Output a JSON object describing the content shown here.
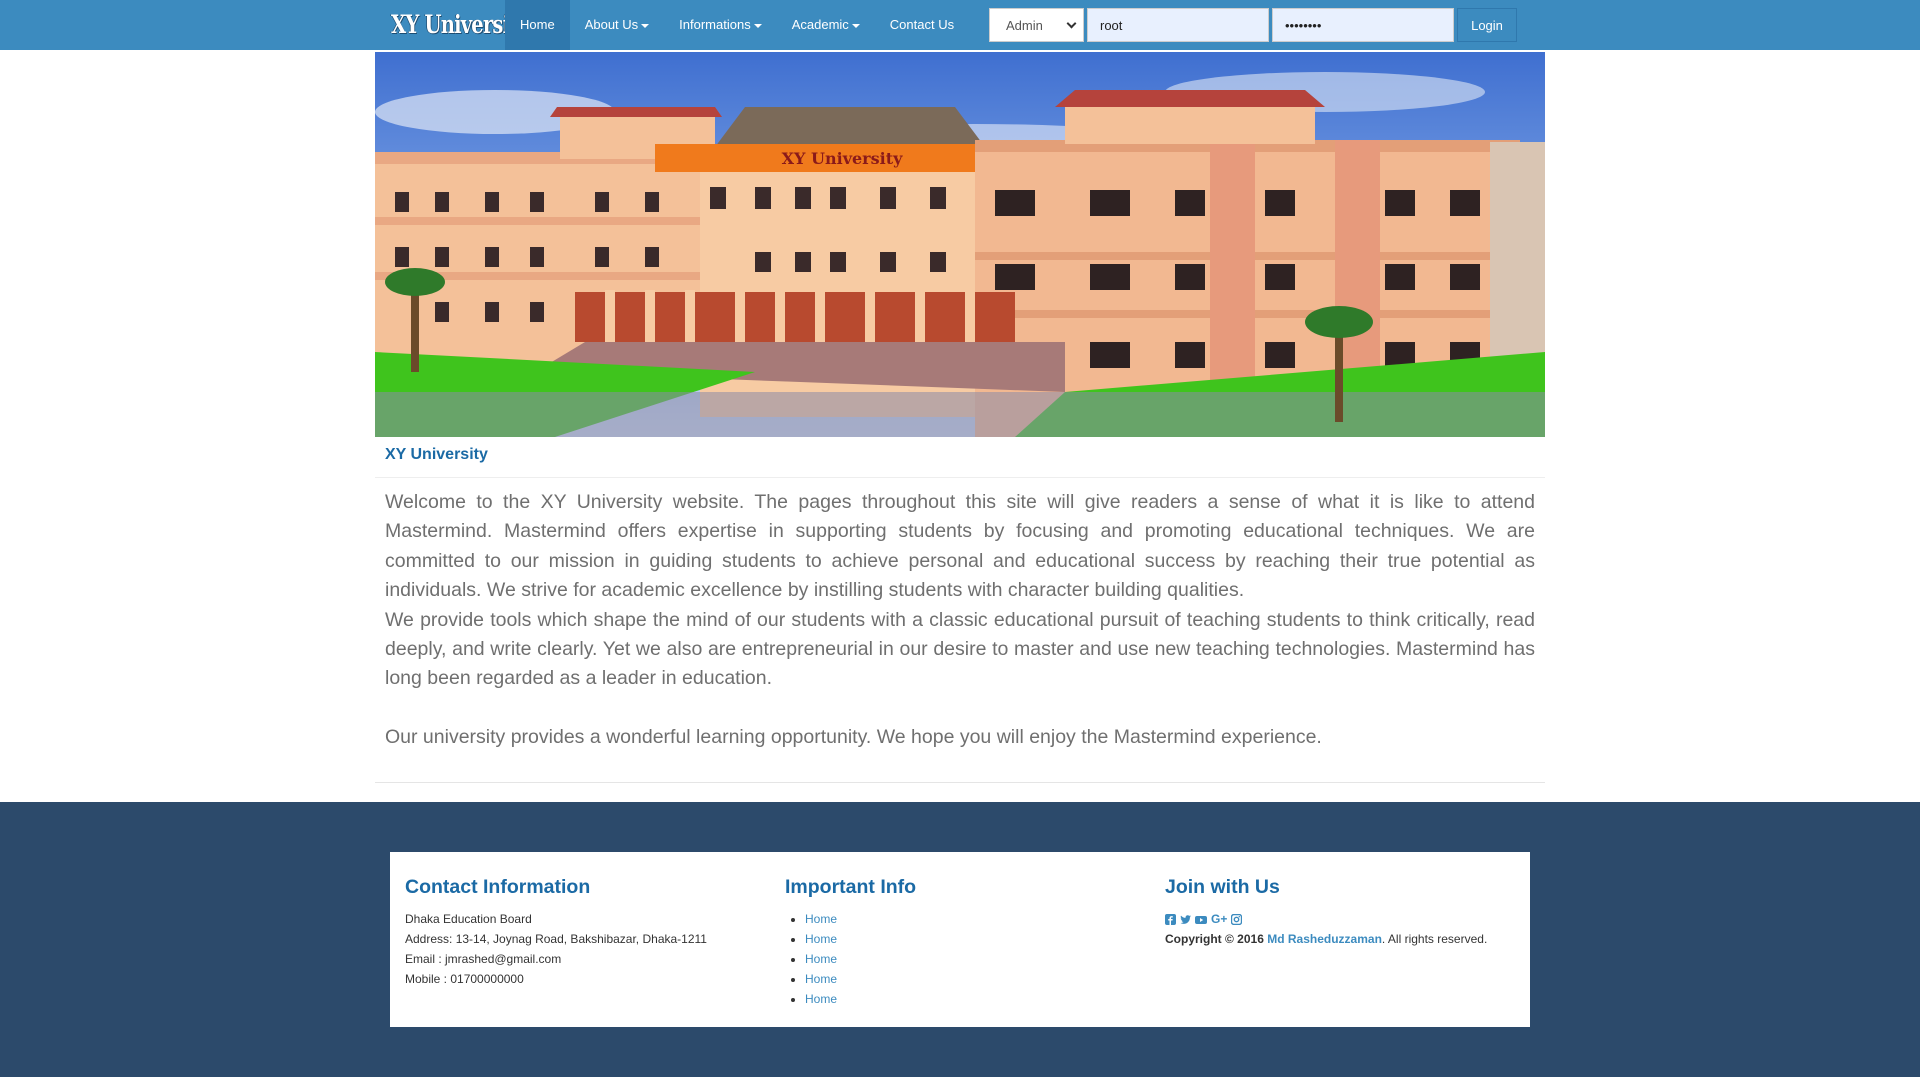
{
  "navbar": {
    "brand": "XY University",
    "items": [
      {
        "label": "Home",
        "active": true,
        "dropdown": false
      },
      {
        "label": "About Us",
        "active": false,
        "dropdown": true
      },
      {
        "label": "Informations",
        "active": false,
        "dropdown": true
      },
      {
        "label": "Academic",
        "active": false,
        "dropdown": true
      },
      {
        "label": "Contact Us",
        "active": false,
        "dropdown": false
      }
    ],
    "login": {
      "role_selected": "Admin",
      "username_value": "root",
      "password_value": "••••••••",
      "button_label": "Login"
    }
  },
  "hero": {
    "sign_text": "XY University"
  },
  "about": {
    "title": "XY University",
    "paragraph1": "Welcome to the XY University website. The pages throughout this site will give readers a sense of what it is like to attend Mastermind. Mastermind offers expertise in supporting students by focusing and promoting educational techniques. We are committed to our mission in guiding students to achieve personal and educational success by reaching their true potential as individuals. We strive for academic excellence by instilling students with character building qualities.",
    "paragraph2": "We provide tools which shape the mind of our students with a classic educational pursuit of teaching students to think critically, read deeply, and write clearly. Yet we also are entrepreneurial in our desire to master and use new teaching technologies. Mastermind has long been regarded as a leader in education.",
    "paragraph3": "Our university provides a wonderful learning opportunity. We hope you will enjoy the Mastermind experience."
  },
  "footer": {
    "contact": {
      "title": "Contact Information",
      "org": "Dhaka Education Board",
      "address": "Address: 13-14, Joynag Road, Bakshibazar, Dhaka-1211",
      "email": "Email : jmrashed@gmail.com",
      "mobile": "Mobile : 01700000000"
    },
    "important": {
      "title": "Important Info",
      "links": [
        "Home",
        "Home",
        "Home",
        "Home",
        "Home"
      ]
    },
    "join": {
      "title": "Join with Us",
      "social_icons": [
        "facebook-icon",
        "twitter-icon",
        "youtube-icon",
        "google-plus-icon",
        "instagram-icon"
      ],
      "copyright_prefix": "Copyright © 2016",
      "author": "Md Rasheduzzaman",
      "copyright_suffix": ". All rights reserved."
    }
  },
  "colors": {
    "navbar": "#3c8bbf",
    "nav_active": "#2f78ad",
    "accent_text": "#1b6aa5",
    "footer_bg": "#2c4a6b"
  }
}
